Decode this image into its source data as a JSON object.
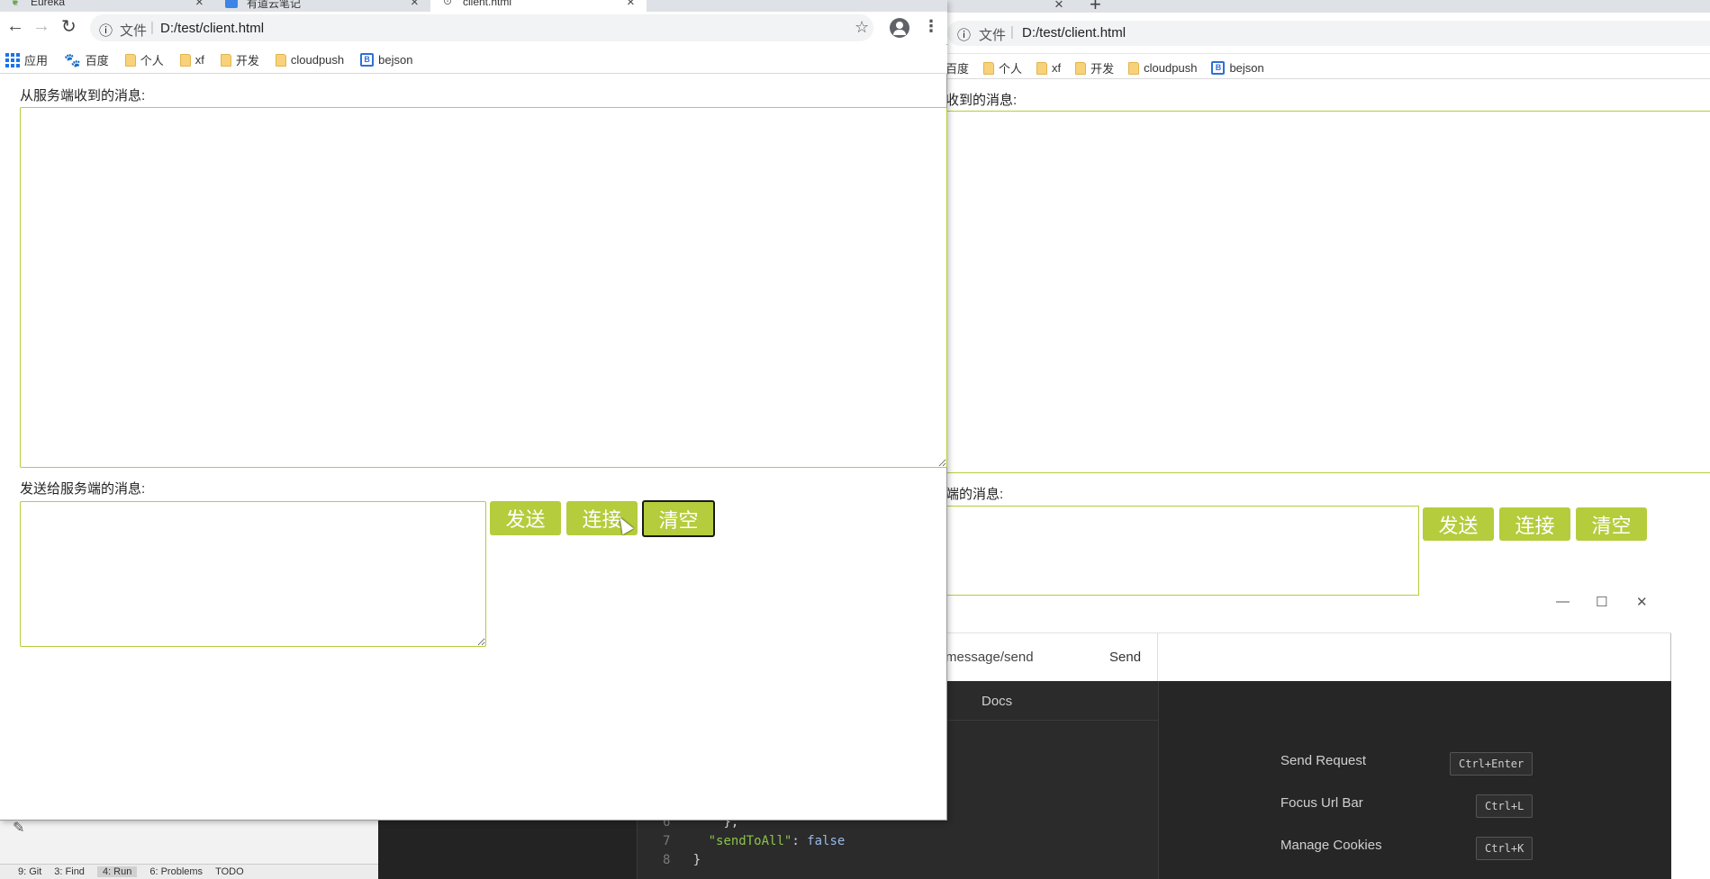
{
  "browser": {
    "tabs": [
      {
        "label": "Eureka"
      },
      {
        "label": "有道云笔记"
      },
      {
        "label": "client.html"
      }
    ],
    "address": {
      "security_label": "文件",
      "url": "D:/test/client.html"
    },
    "bookmarks": [
      {
        "label": "应用",
        "icon": "apps-grid-icon"
      },
      {
        "label": "百度",
        "icon": "baidu-paw-icon"
      },
      {
        "label": "个人",
        "icon": "folder-icon"
      },
      {
        "label": "xf",
        "icon": "folder-icon"
      },
      {
        "label": "开发",
        "icon": "folder-icon"
      },
      {
        "label": "cloudpush",
        "icon": "folder-icon"
      },
      {
        "label": "bejson",
        "icon": "bejson-icon"
      }
    ],
    "bookmarks_right": [
      {
        "label": "百度"
      },
      {
        "label": "个人"
      },
      {
        "label": "xf"
      },
      {
        "label": "开发"
      },
      {
        "label": "cloudpush"
      },
      {
        "label": "bejson"
      }
    ]
  },
  "page": {
    "received_label": "从服务端收到的消息:",
    "received_value": "",
    "send_label": "发送给服务端的消息:",
    "send_value": "",
    "buttons": {
      "send": "发送",
      "connect": "连接",
      "clear": "清空"
    },
    "accent_color": "#b5cc3c"
  },
  "page_right": {
    "received_label_partial": "收到的消息:",
    "send_label_partial": "端的消息:"
  },
  "api_tool": {
    "url_partial": "message/send",
    "send_button": "Send",
    "docs_tab": "Docs",
    "code_lines": [
      {
        "num": "6",
        "text": "  },"
      },
      {
        "num": "7",
        "key": "\"sendToAll\"",
        "value": "false"
      },
      {
        "num": "8",
        "text": "}"
      }
    ],
    "shortcuts": [
      {
        "label": "Send Request",
        "key": "Ctrl+Enter"
      },
      {
        "label": "Focus Url Bar",
        "key": "Ctrl+L"
      },
      {
        "label": "Manage Cookies",
        "key": "Ctrl+K"
      }
    ]
  },
  "ide": {
    "status_items": [
      "9: Git",
      "3: Find",
      "4: Run",
      "6: Problems",
      "TODO"
    ]
  }
}
